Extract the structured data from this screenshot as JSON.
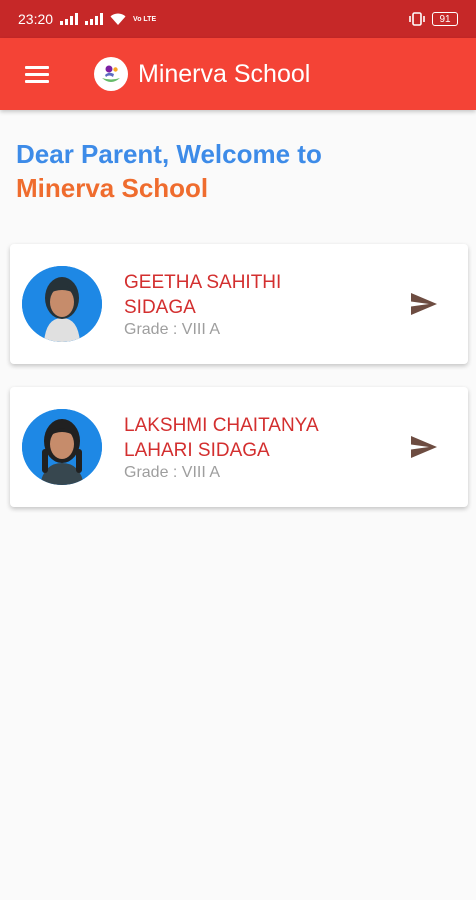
{
  "status_bar": {
    "time": "23:20",
    "network_label": "Vo LTE",
    "battery": "91",
    "icons": [
      "signal-icon",
      "wifi-icon",
      "vibrate-icon",
      "battery-icon"
    ]
  },
  "app_bar": {
    "title": "Minerva School",
    "icons": [
      "menu-icon",
      "school-logo"
    ],
    "color": "#f44336"
  },
  "welcome": {
    "line1": "Dear Parent, Welcome to",
    "line2": "Minerva School"
  },
  "students": [
    {
      "name": "GEETHA SAHITHI\nSIDAGA",
      "grade": "Grade : VIII A"
    },
    {
      "name": "LAKSHMI CHAITANYA\nLAHARI  SIDAGA",
      "grade": "Grade : VIII A"
    }
  ],
  "colors": {
    "status_bar": "#c62828",
    "welcome_blue": "#3d8be8",
    "welcome_orange": "#ef6c2e",
    "student_name": "#d32f2f",
    "send_icon": "#6d4c41"
  }
}
